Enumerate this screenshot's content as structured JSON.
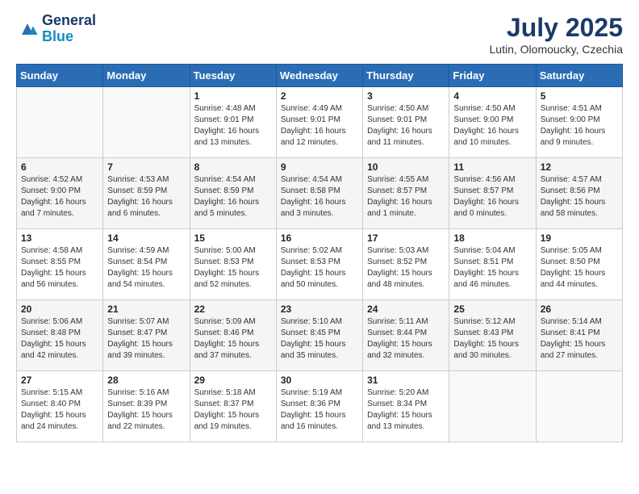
{
  "header": {
    "logo_sub": "Blue",
    "month_year": "July 2025",
    "location": "Lutin, Olomoucky, Czechia"
  },
  "calendar": {
    "days": [
      "Sunday",
      "Monday",
      "Tuesday",
      "Wednesday",
      "Thursday",
      "Friday",
      "Saturday"
    ]
  },
  "weeks": [
    [
      null,
      null,
      {
        "day": 1,
        "sunrise": "Sunrise: 4:48 AM",
        "sunset": "Sunset: 9:01 PM",
        "daylight": "Daylight: 16 hours and 13 minutes."
      },
      {
        "day": 2,
        "sunrise": "Sunrise: 4:49 AM",
        "sunset": "Sunset: 9:01 PM",
        "daylight": "Daylight: 16 hours and 12 minutes."
      },
      {
        "day": 3,
        "sunrise": "Sunrise: 4:50 AM",
        "sunset": "Sunset: 9:01 PM",
        "daylight": "Daylight: 16 hours and 11 minutes."
      },
      {
        "day": 4,
        "sunrise": "Sunrise: 4:50 AM",
        "sunset": "Sunset: 9:00 PM",
        "daylight": "Daylight: 16 hours and 10 minutes."
      },
      {
        "day": 5,
        "sunrise": "Sunrise: 4:51 AM",
        "sunset": "Sunset: 9:00 PM",
        "daylight": "Daylight: 16 hours and 9 minutes."
      }
    ],
    [
      {
        "day": 6,
        "sunrise": "Sunrise: 4:52 AM",
        "sunset": "Sunset: 9:00 PM",
        "daylight": "Daylight: 16 hours and 7 minutes."
      },
      {
        "day": 7,
        "sunrise": "Sunrise: 4:53 AM",
        "sunset": "Sunset: 8:59 PM",
        "daylight": "Daylight: 16 hours and 6 minutes."
      },
      {
        "day": 8,
        "sunrise": "Sunrise: 4:54 AM",
        "sunset": "Sunset: 8:59 PM",
        "daylight": "Daylight: 16 hours and 5 minutes."
      },
      {
        "day": 9,
        "sunrise": "Sunrise: 4:54 AM",
        "sunset": "Sunset: 8:58 PM",
        "daylight": "Daylight: 16 hours and 3 minutes."
      },
      {
        "day": 10,
        "sunrise": "Sunrise: 4:55 AM",
        "sunset": "Sunset: 8:57 PM",
        "daylight": "Daylight: 16 hours and 1 minute."
      },
      {
        "day": 11,
        "sunrise": "Sunrise: 4:56 AM",
        "sunset": "Sunset: 8:57 PM",
        "daylight": "Daylight: 16 hours and 0 minutes."
      },
      {
        "day": 12,
        "sunrise": "Sunrise: 4:57 AM",
        "sunset": "Sunset: 8:56 PM",
        "daylight": "Daylight: 15 hours and 58 minutes."
      }
    ],
    [
      {
        "day": 13,
        "sunrise": "Sunrise: 4:58 AM",
        "sunset": "Sunset: 8:55 PM",
        "daylight": "Daylight: 15 hours and 56 minutes."
      },
      {
        "day": 14,
        "sunrise": "Sunrise: 4:59 AM",
        "sunset": "Sunset: 8:54 PM",
        "daylight": "Daylight: 15 hours and 54 minutes."
      },
      {
        "day": 15,
        "sunrise": "Sunrise: 5:00 AM",
        "sunset": "Sunset: 8:53 PM",
        "daylight": "Daylight: 15 hours and 52 minutes."
      },
      {
        "day": 16,
        "sunrise": "Sunrise: 5:02 AM",
        "sunset": "Sunset: 8:53 PM",
        "daylight": "Daylight: 15 hours and 50 minutes."
      },
      {
        "day": 17,
        "sunrise": "Sunrise: 5:03 AM",
        "sunset": "Sunset: 8:52 PM",
        "daylight": "Daylight: 15 hours and 48 minutes."
      },
      {
        "day": 18,
        "sunrise": "Sunrise: 5:04 AM",
        "sunset": "Sunset: 8:51 PM",
        "daylight": "Daylight: 15 hours and 46 minutes."
      },
      {
        "day": 19,
        "sunrise": "Sunrise: 5:05 AM",
        "sunset": "Sunset: 8:50 PM",
        "daylight": "Daylight: 15 hours and 44 minutes."
      }
    ],
    [
      {
        "day": 20,
        "sunrise": "Sunrise: 5:06 AM",
        "sunset": "Sunset: 8:48 PM",
        "daylight": "Daylight: 15 hours and 42 minutes."
      },
      {
        "day": 21,
        "sunrise": "Sunrise: 5:07 AM",
        "sunset": "Sunset: 8:47 PM",
        "daylight": "Daylight: 15 hours and 39 minutes."
      },
      {
        "day": 22,
        "sunrise": "Sunrise: 5:09 AM",
        "sunset": "Sunset: 8:46 PM",
        "daylight": "Daylight: 15 hours and 37 minutes."
      },
      {
        "day": 23,
        "sunrise": "Sunrise: 5:10 AM",
        "sunset": "Sunset: 8:45 PM",
        "daylight": "Daylight: 15 hours and 35 minutes."
      },
      {
        "day": 24,
        "sunrise": "Sunrise: 5:11 AM",
        "sunset": "Sunset: 8:44 PM",
        "daylight": "Daylight: 15 hours and 32 minutes."
      },
      {
        "day": 25,
        "sunrise": "Sunrise: 5:12 AM",
        "sunset": "Sunset: 8:43 PM",
        "daylight": "Daylight: 15 hours and 30 minutes."
      },
      {
        "day": 26,
        "sunrise": "Sunrise: 5:14 AM",
        "sunset": "Sunset: 8:41 PM",
        "daylight": "Daylight: 15 hours and 27 minutes."
      }
    ],
    [
      {
        "day": 27,
        "sunrise": "Sunrise: 5:15 AM",
        "sunset": "Sunset: 8:40 PM",
        "daylight": "Daylight: 15 hours and 24 minutes."
      },
      {
        "day": 28,
        "sunrise": "Sunrise: 5:16 AM",
        "sunset": "Sunset: 8:39 PM",
        "daylight": "Daylight: 15 hours and 22 minutes."
      },
      {
        "day": 29,
        "sunrise": "Sunrise: 5:18 AM",
        "sunset": "Sunset: 8:37 PM",
        "daylight": "Daylight: 15 hours and 19 minutes."
      },
      {
        "day": 30,
        "sunrise": "Sunrise: 5:19 AM",
        "sunset": "Sunset: 8:36 PM",
        "daylight": "Daylight: 15 hours and 16 minutes."
      },
      {
        "day": 31,
        "sunrise": "Sunrise: 5:20 AM",
        "sunset": "Sunset: 8:34 PM",
        "daylight": "Daylight: 15 hours and 13 minutes."
      },
      null,
      null
    ]
  ]
}
